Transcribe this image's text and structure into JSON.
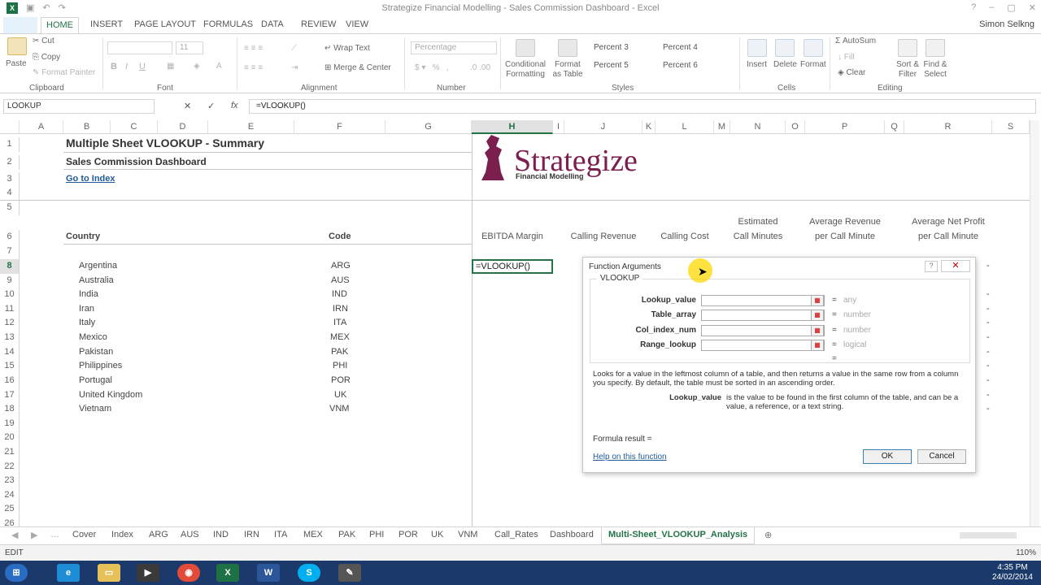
{
  "window": {
    "title": "Strategize Financial Modelling - Sales Commission Dashboard - Excel",
    "user": "Simon Selkng"
  },
  "ribbon_tabs": [
    "HOME",
    "INSERT",
    "PAGE LAYOUT",
    "FORMULAS",
    "DATA",
    "REVIEW",
    "VIEW"
  ],
  "ribbon": {
    "clipboard": {
      "paste": "Paste",
      "cut": "Cut",
      "copy": "Copy",
      "format_painter": "Format Painter",
      "label": "Clipboard"
    },
    "font": {
      "size": "11",
      "label": "Font"
    },
    "alignment": {
      "wrap_text": "Wrap Text",
      "merge_center": "Merge & Center",
      "label": "Alignment"
    },
    "number": {
      "format": "Percentage",
      "label": "Number"
    },
    "styles": {
      "conditional": "Conditional Formatting",
      "format_table": "Format as Table",
      "cells": [
        "Percent 3",
        "Percent 4",
        "Percent 5",
        "Percent 6"
      ],
      "label": "Styles"
    },
    "cells": {
      "insert": "Insert",
      "delete": "Delete",
      "format": "Format",
      "label": "Cells"
    },
    "editing": {
      "autosum": "AutoSum",
      "fill": "Fill",
      "clear": "Clear",
      "sort_filter": "Sort & Filter",
      "find_select": "Find & Select",
      "label": "Editing"
    }
  },
  "formula_bar": {
    "name_box": "LOOKUP",
    "formula": "=VLOOKUP()"
  },
  "columns": [
    "A",
    "B",
    "C",
    "D",
    "E",
    "F",
    "G",
    "H",
    "I",
    "J",
    "K",
    "L",
    "M",
    "N",
    "O",
    "P",
    "Q",
    "R",
    "S"
  ],
  "rows": [
    "1",
    "2",
    "3",
    "4",
    "5",
    "6",
    "7",
    "8",
    "9",
    "10",
    "11",
    "12",
    "13",
    "14",
    "15",
    "16",
    "17",
    "18",
    "19",
    "20",
    "21",
    "22",
    "23",
    "24",
    "25",
    "26"
  ],
  "sheet": {
    "title": "Multiple Sheet VLOOKUP - Summary",
    "subtitle": "Sales Commission Dashboard",
    "index_link": "Go to Index",
    "brand": "Strategize",
    "brand_tagline": "Financial Modelling",
    "country_header": "Country",
    "code_header": "Code",
    "metric_headers": [
      "EBITDA Margin",
      "Calling Revenue",
      "Calling Cost",
      "Estimated\nCall Minutes",
      "Average Revenue\nper Call Minute",
      "Average Net Profit\nper Call Minute"
    ],
    "countries": [
      {
        "name": "Argentina",
        "code": "ARG"
      },
      {
        "name": "Australia",
        "code": "AUS"
      },
      {
        "name": "India",
        "code": "IND"
      },
      {
        "name": "Iran",
        "code": "IRN"
      },
      {
        "name": "Italy",
        "code": "ITA"
      },
      {
        "name": "Mexico",
        "code": "MEX"
      },
      {
        "name": "Pakistan",
        "code": "PAK"
      },
      {
        "name": "Philippines",
        "code": "PHI"
      },
      {
        "name": "Portugal",
        "code": "POR"
      },
      {
        "name": "United Kingdom",
        "code": "UK"
      },
      {
        "name": "Vietnam",
        "code": "VNM"
      }
    ],
    "active_cell_value": "=VLOOKUP()",
    "dash": "-"
  },
  "dialog": {
    "title": "Function Arguments",
    "function_name": "VLOOKUP",
    "args": [
      {
        "label": "Lookup_value",
        "hint": "any"
      },
      {
        "label": "Table_array",
        "hint": "number"
      },
      {
        "label": "Col_index_num",
        "hint": "number"
      },
      {
        "label": "Range_lookup",
        "hint": "logical"
      }
    ],
    "equals": "=",
    "description": "Looks for a value in the leftmost column of a table, and then returns a value in the same row from a column you specify. By default, the table must be sorted in an ascending order.",
    "arg_desc_label": "Lookup_value",
    "arg_desc": "is the value to be found in the first column of the table, and can be a value, a reference, or a text string.",
    "formula_result": "Formula result =",
    "help_link": "Help on this function",
    "ok": "OK",
    "cancel": "Cancel"
  },
  "sheet_tabs": [
    "Cover",
    "Index",
    "ARG",
    "AUS",
    "IND",
    "IRN",
    "ITA",
    "MEX",
    "PAK",
    "PHI",
    "POR",
    "UK",
    "VNM",
    "Call_Rates",
    "Dashboard",
    "Multi-Sheet_VLOOKUP_Analysis"
  ],
  "active_sheet_tab": "Multi-Sheet_VLOOKUP_Analysis",
  "status": {
    "mode": "EDIT",
    "zoom": "110%"
  },
  "taskbar": {
    "time": "4:35 PM",
    "date": "24/02/2014"
  },
  "colors": {
    "excel_green": "#217346",
    "brand_purple": "#7b1f4f",
    "link_blue": "#1f5b99",
    "taskbar": "#1b3a6b"
  }
}
